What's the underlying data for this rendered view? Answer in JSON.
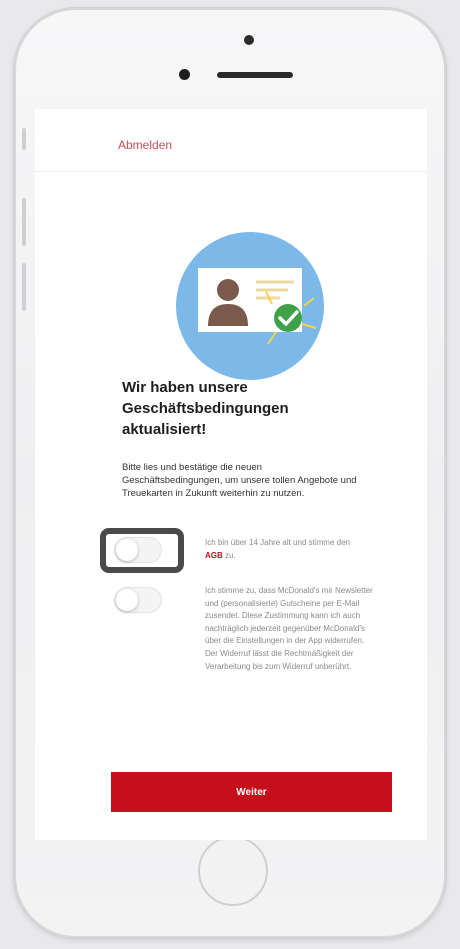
{
  "header": {
    "logout_label": "Abmelden"
  },
  "title": "Wir haben unsere Geschäftsbedingungen aktualisiert!",
  "intro": "Bitte lies und bestätige die neuen Geschäftsbedingungen, um unsere tollen Angebote und Treuekarten in Zukunft weiterhin zu nutzen.",
  "consents": [
    {
      "text_before": "Ich bin über 14 Jahre alt und stimme den",
      "link": "AGB",
      "text_after": " zu.",
      "checked": false
    },
    {
      "text": "Ich stimme zu, dass McDonald's mir Newsletter und (personalisierte) Gutscheine per E-Mail zusendet. Diese Zustimmung kann ich auch nachträglich jederzeit gegenüber McDonald's über die Einstellungen in der App widerrufen. Der Widerruf lässt die Rechtmäßigkeit der Verarbeitung bis zum Widerruf unberührt.",
      "checked": false
    }
  ],
  "button": {
    "weiter_label": "Weiter"
  },
  "icons": {
    "illustration": "profile-card-check-illustration",
    "home": "home-button"
  },
  "colors": {
    "accent_red": "#c5101b",
    "link_red": "#c1121f",
    "illustration_circle": "#7cb8e8",
    "check_green": "#3fa24b",
    "avatar_brown": "#7a5a4a"
  }
}
